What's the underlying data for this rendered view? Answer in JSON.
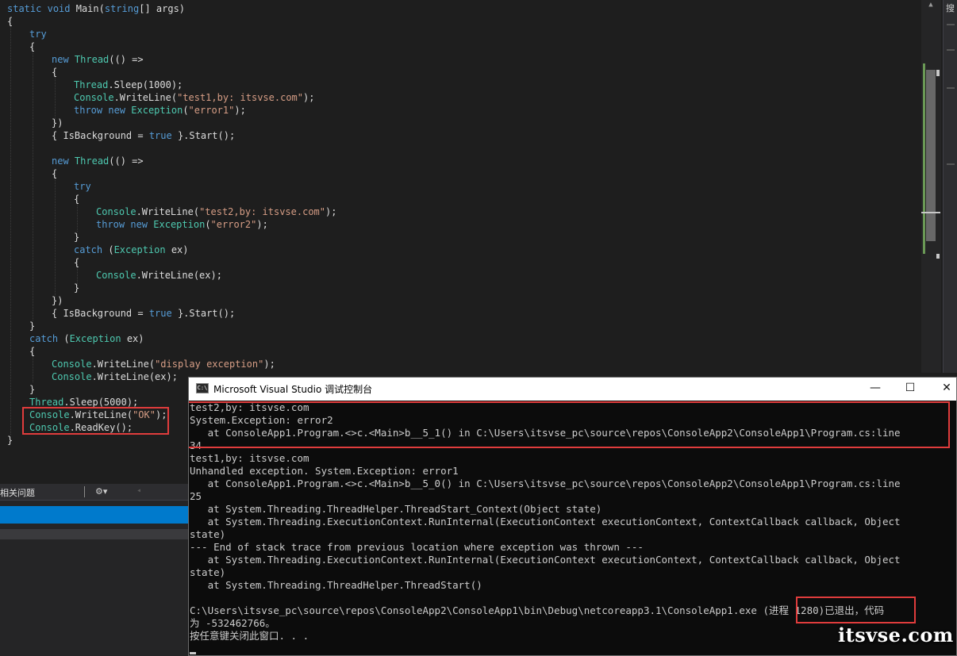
{
  "editor": {
    "lines": [
      [
        [
          "static",
          "kw"
        ],
        [
          " ",
          "pl"
        ],
        [
          "void",
          "kw"
        ],
        [
          " Main(",
          "pl"
        ],
        [
          "string",
          "kw"
        ],
        [
          "[] args)",
          "pl"
        ]
      ],
      [
        [
          "{",
          "pl"
        ]
      ],
      [
        [
          "try",
          "kw"
        ]
      ],
      [
        [
          "{",
          "pl"
        ]
      ],
      [
        [
          "new",
          "kw"
        ],
        [
          " ",
          "pl"
        ],
        [
          "Thread",
          "ty"
        ],
        [
          "(() =>",
          "pl"
        ]
      ],
      [
        [
          "{",
          "pl"
        ]
      ],
      [
        [
          "Thread",
          "ty"
        ],
        [
          ".Sleep(1000);",
          "pl"
        ]
      ],
      [
        [
          "Console",
          "ty"
        ],
        [
          ".WriteLine(",
          "pl"
        ],
        [
          "\"test1,by: itsvse.com\"",
          "st"
        ],
        [
          ");",
          "pl"
        ]
      ],
      [
        [
          "throw",
          "kw"
        ],
        [
          " ",
          "pl"
        ],
        [
          "new",
          "kw"
        ],
        [
          " ",
          "pl"
        ],
        [
          "Exception",
          "ty"
        ],
        [
          "(",
          "pl"
        ],
        [
          "\"error1\"",
          "st"
        ],
        [
          ");",
          "pl"
        ]
      ],
      [
        [
          "})",
          "pl"
        ]
      ],
      [
        [
          "{ IsBackground = ",
          "pl"
        ],
        [
          "true",
          "kw"
        ],
        [
          " }.Start();",
          "pl"
        ]
      ],
      [],
      [
        [
          "new",
          "kw"
        ],
        [
          " ",
          "pl"
        ],
        [
          "Thread",
          "ty"
        ],
        [
          "(() =>",
          "pl"
        ]
      ],
      [
        [
          "{",
          "pl"
        ]
      ],
      [
        [
          "try",
          "kw"
        ]
      ],
      [
        [
          "{",
          "pl"
        ]
      ],
      [
        [
          "Console",
          "ty"
        ],
        [
          ".WriteLine(",
          "pl"
        ],
        [
          "\"test2,by: itsvse.com\"",
          "st"
        ],
        [
          ");",
          "pl"
        ]
      ],
      [
        [
          "throw",
          "kw"
        ],
        [
          " ",
          "pl"
        ],
        [
          "new",
          "kw"
        ],
        [
          " ",
          "pl"
        ],
        [
          "Exception",
          "ty"
        ],
        [
          "(",
          "pl"
        ],
        [
          "\"error2\"",
          "st"
        ],
        [
          ");",
          "pl"
        ]
      ],
      [
        [
          "}",
          "pl"
        ]
      ],
      [
        [
          "catch",
          "kw"
        ],
        [
          " (",
          "pl"
        ],
        [
          "Exception",
          "ty"
        ],
        [
          " ex)",
          "pl"
        ]
      ],
      [
        [
          "{",
          "pl"
        ]
      ],
      [
        [
          "Console",
          "ty"
        ],
        [
          ".WriteLine(ex);",
          "pl"
        ]
      ],
      [
        [
          "}",
          "pl"
        ]
      ],
      [
        [
          "})",
          "pl"
        ]
      ],
      [
        [
          "{ IsBackground = ",
          "pl"
        ],
        [
          "true",
          "kw"
        ],
        [
          " }.Start();",
          "pl"
        ]
      ],
      [
        [
          "}",
          "pl"
        ]
      ],
      [
        [
          "catch",
          "kw"
        ],
        [
          " (",
          "pl"
        ],
        [
          "Exception",
          "ty"
        ],
        [
          " ex)",
          "pl"
        ]
      ],
      [
        [
          "{",
          "pl"
        ]
      ],
      [
        [
          "Console",
          "ty"
        ],
        [
          ".WriteLine(",
          "pl"
        ],
        [
          "\"display exception\"",
          "st"
        ],
        [
          ");",
          "pl"
        ]
      ],
      [
        [
          "Console",
          "ty"
        ],
        [
          ".WriteLine(ex);",
          "pl"
        ]
      ],
      [
        [
          "}",
          "pl"
        ]
      ],
      [
        [
          "Thread",
          "ty"
        ],
        [
          ".Sleep(5000);",
          "pl"
        ]
      ],
      [
        [
          "Console",
          "ty"
        ],
        [
          ".WriteLine(",
          "pl"
        ],
        [
          "\"OK\"",
          "st"
        ],
        [
          ");",
          "pl"
        ]
      ],
      [
        [
          "Console",
          "ty"
        ],
        [
          ".ReadKey();",
          "pl"
        ]
      ],
      [
        [
          "}",
          "pl"
        ]
      ]
    ]
  },
  "right_panel": {
    "tab_label": "搜"
  },
  "bottom_panel": {
    "tab_label": "相关问题",
    "filter_icon": "filter-icon",
    "dropdown_glyph": "▾",
    "left_arrow": "◂"
  },
  "console": {
    "title": "Microsoft Visual Studio 调试控制台",
    "icon_text": "C:\\",
    "minimize_glyph": "—",
    "maximize_glyph": "☐",
    "close_glyph": "✕",
    "lines": [
      "test2,by: itsvse.com",
      "System.Exception: error2",
      "   at ConsoleApp1.Program.<>c.<Main>b__5_1() in C:\\Users\\itsvse_pc\\source\\repos\\ConsoleApp2\\ConsoleApp1\\Program.cs:line",
      "34",
      "test1,by: itsvse.com",
      "Unhandled exception. System.Exception: error1",
      "   at ConsoleApp1.Program.<>c.<Main>b__5_0() in C:\\Users\\itsvse_pc\\source\\repos\\ConsoleApp2\\ConsoleApp1\\Program.cs:line",
      "25",
      "   at System.Threading.ThreadHelper.ThreadStart_Context(Object state)",
      "   at System.Threading.ExecutionContext.RunInternal(ExecutionContext executionContext, ContextCallback callback, Object",
      "state)",
      "--- End of stack trace from previous location where exception was thrown ---",
      "   at System.Threading.ExecutionContext.RunInternal(ExecutionContext executionContext, ContextCallback callback, Object",
      "state)",
      "   at System.Threading.ThreadHelper.ThreadStart()",
      "",
      "C:\\Users\\itsvse_pc\\source\\repos\\ConsoleApp2\\ConsoleApp1\\bin\\Debug\\netcoreapp3.1\\ConsoleApp1.exe (进程 1280)已退出，代码",
      "为 -532462766。",
      "按任意键关闭此窗口. . ."
    ]
  },
  "watermark": "itsvse.com",
  "colors": {
    "keyword": "#569cd6",
    "type": "#4ec9b0",
    "string": "#d69d85",
    "highlight_box": "#e03c3c",
    "selection_bar": "#007acc"
  }
}
